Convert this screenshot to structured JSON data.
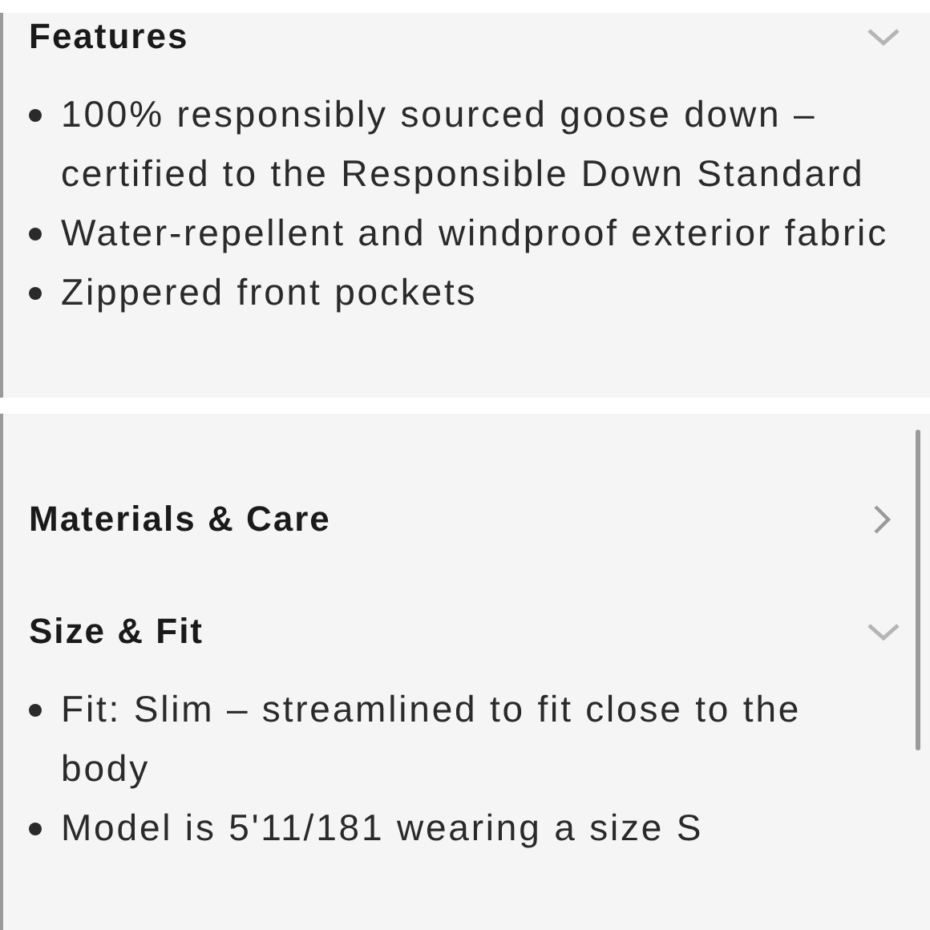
{
  "sections_top": [
    {
      "title": "Features",
      "expanded": true,
      "items": [
        "100% responsibly sourced goose down – certified to the Responsible Down Standard",
        "Water-repellent and windproof exterior fabric",
        "Zippered front pockets"
      ]
    }
  ],
  "sections_bottom": [
    {
      "title": "Materials & Care",
      "expanded": false
    },
    {
      "title": "Size & Fit",
      "expanded": true,
      "items": [
        "Fit: Slim – streamlined to fit close to the body",
        "Model is 5'11/181 wearing a size S"
      ]
    }
  ]
}
